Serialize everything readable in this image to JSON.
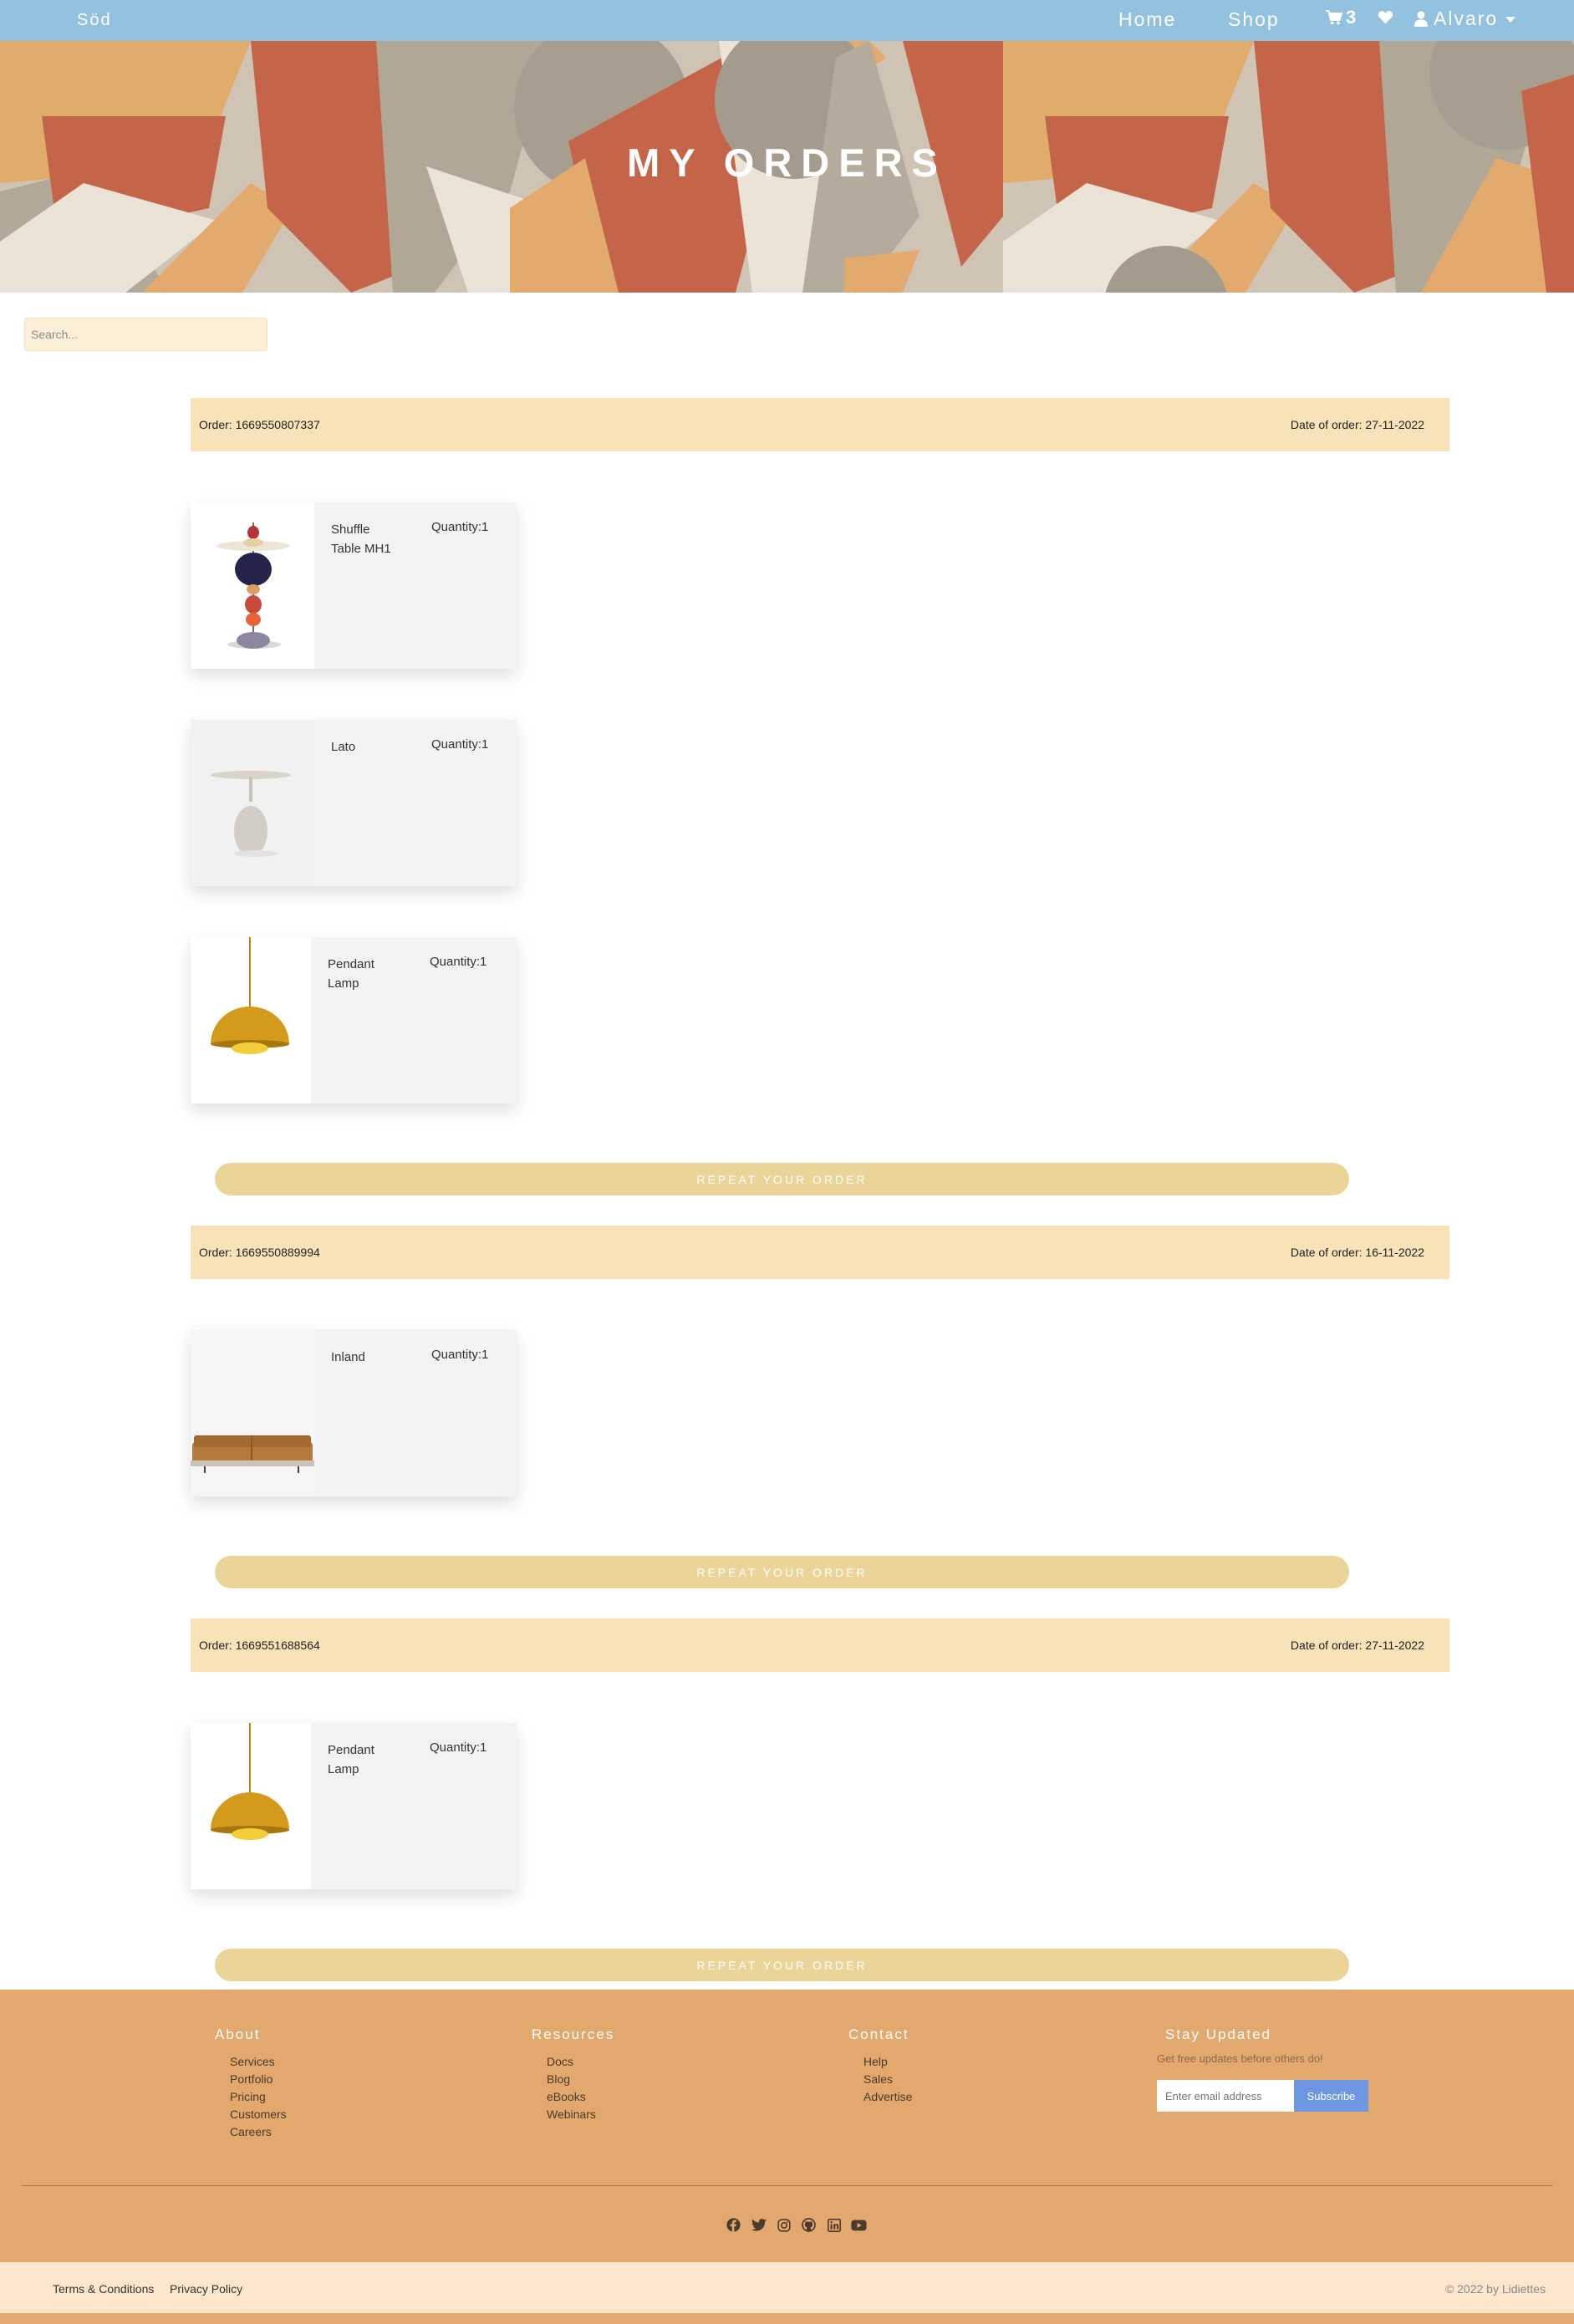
{
  "navbar": {
    "brand": "Söd",
    "links": [
      {
        "label": "Home"
      },
      {
        "label": "Shop"
      }
    ],
    "cart_count": "3",
    "user_name": "Alvaro"
  },
  "hero": {
    "title": "MY ORDERS"
  },
  "search": {
    "placeholder": "Search..."
  },
  "orders": [
    {
      "id_label": "Order: 1669550807337",
      "date_label": "Date of order: 27-11-2022",
      "items": [
        {
          "name": "Shuffle Table MH1",
          "quantity_label": "Quantity:1"
        },
        {
          "name": "Lato",
          "quantity_label": "Quantity:1"
        },
        {
          "name": "Pendant Lamp",
          "quantity_label": "Quantity:1"
        }
      ],
      "button_label": "REPEAT YOUR ORDER"
    },
    {
      "id_label": "Order: 1669550889994",
      "date_label": "Date of order: 16-11-2022",
      "items": [
        {
          "name": "Inland",
          "quantity_label": "Quantity:1"
        }
      ],
      "button_label": "REPEAT YOUR ORDER"
    },
    {
      "id_label": "Order: 1669551688564",
      "date_label": "Date of order: 27-11-2022",
      "items": [
        {
          "name": "Pendant Lamp",
          "quantity_label": "Quantity:1"
        }
      ],
      "button_label": "REPEAT YOUR ORDER"
    }
  ],
  "footer": {
    "about": {
      "title": "About",
      "links": [
        "Services",
        "Portfolio",
        "Pricing",
        "Customers",
        "Careers"
      ]
    },
    "resources": {
      "title": "Resources",
      "links": [
        "Docs",
        "Blog",
        "eBooks",
        "Webinars"
      ]
    },
    "contact": {
      "title": "Contact",
      "links": [
        "Help",
        "Sales",
        "Advertise"
      ]
    },
    "newsletter": {
      "title": "Stay Updated",
      "text": "Get free updates before others do!",
      "email_placeholder": "Enter email address",
      "button_label": "Subscribe"
    },
    "social_icons": [
      "facebook-icon",
      "twitter-icon",
      "instagram-icon",
      "github-icon",
      "linkedin-icon",
      "youtube-icon"
    ],
    "bottom": {
      "terms": "Terms & Conditions",
      "privacy": "Privacy Policy",
      "copyright": "© 2022 by Lidiettes"
    }
  }
}
